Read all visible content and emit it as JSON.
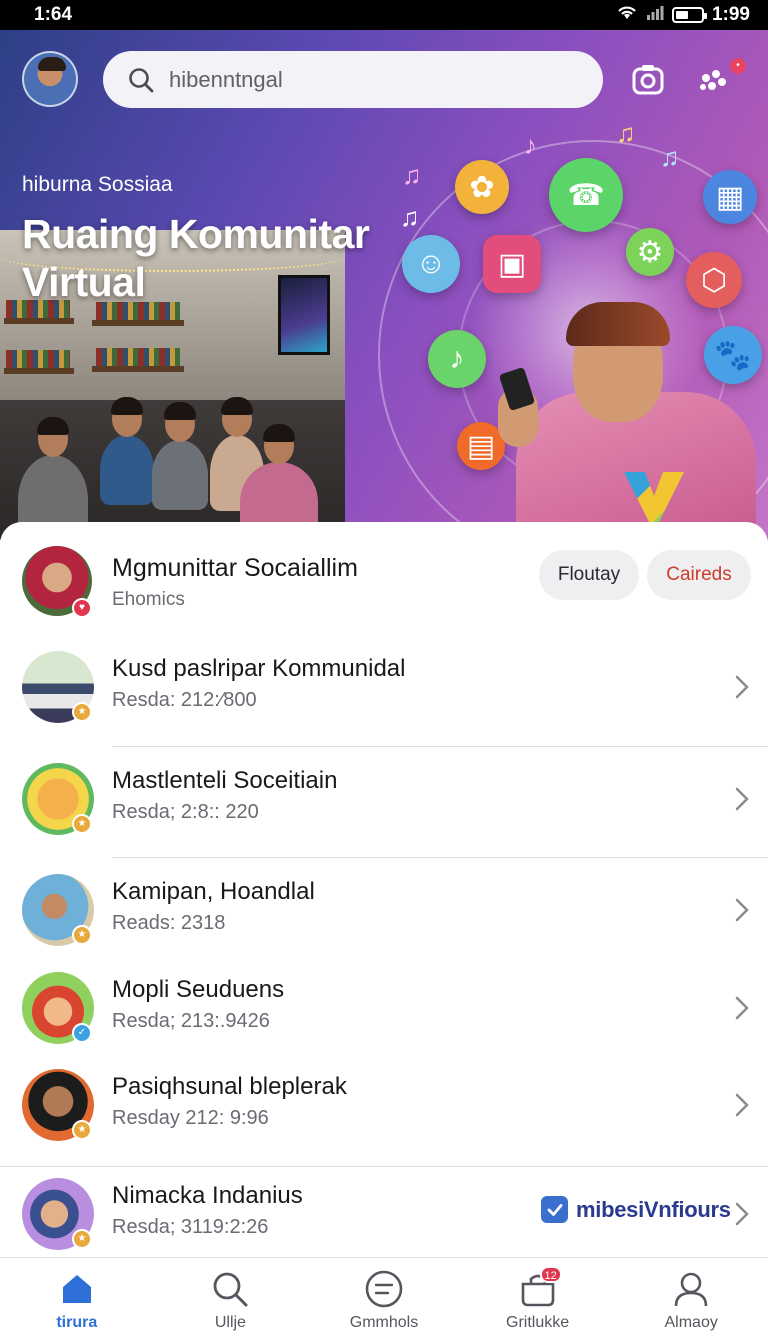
{
  "status_bar": {
    "time_left": "1:64",
    "time_right": "1:99"
  },
  "header": {
    "search_placeholder": "hibenntngal",
    "hero_subtitle": "hiburna Sossiaa",
    "hero_title": "Ruaing Komunitar Virtual",
    "carousel_dots": 6,
    "carousel_active": 1
  },
  "featured": {
    "title": "Mgmunittar Socaiallim",
    "subtitle": "Ehomics",
    "follow_label": "Floutay",
    "cards_label": "Caireds"
  },
  "list": [
    {
      "title": "Kusd paslripar Kommunidal",
      "subtitle": "Resda: 212:⁄800",
      "badge_color": "#e8a93a"
    },
    {
      "title": "Mastlenteli Soceitiain",
      "subtitle": "Resda; 2:8:: 220",
      "badge_color": "#e8a93a"
    },
    {
      "title": "Kamipan, Hoandlal",
      "subtitle": "Reads: 2318",
      "badge_color": "#e8a93a"
    },
    {
      "title": "Mopli Seuduens",
      "subtitle": "Resda; 213:.9426",
      "badge_color": "#3fa0e0"
    },
    {
      "title": "Pasiqhsunal bleplerak",
      "subtitle": "Resday 212: 9:96",
      "badge_color": "#e8a93a"
    },
    {
      "title": "Nimacka Indanius",
      "subtitle": "Resda; 3119:2:26",
      "badge_color": "#e8a93a",
      "verified_label": "mibesiVnfiours"
    }
  ],
  "bottom_nav": [
    {
      "label": "tirura",
      "icon": "home-icon",
      "active": true
    },
    {
      "label": "Ullje",
      "icon": "search-icon",
      "active": false
    },
    {
      "label": "Gmmhols",
      "icon": "chat-icon",
      "active": false
    },
    {
      "label": "Gritlukke",
      "icon": "bag-icon",
      "active": false,
      "badge": "12"
    },
    {
      "label": "Almaoy",
      "icon": "profile-icon",
      "active": false
    }
  ],
  "colors": {
    "accent": "#2f6fd8",
    "badge_red": "#e0364f",
    "cards_red": "#cf3b2b"
  }
}
